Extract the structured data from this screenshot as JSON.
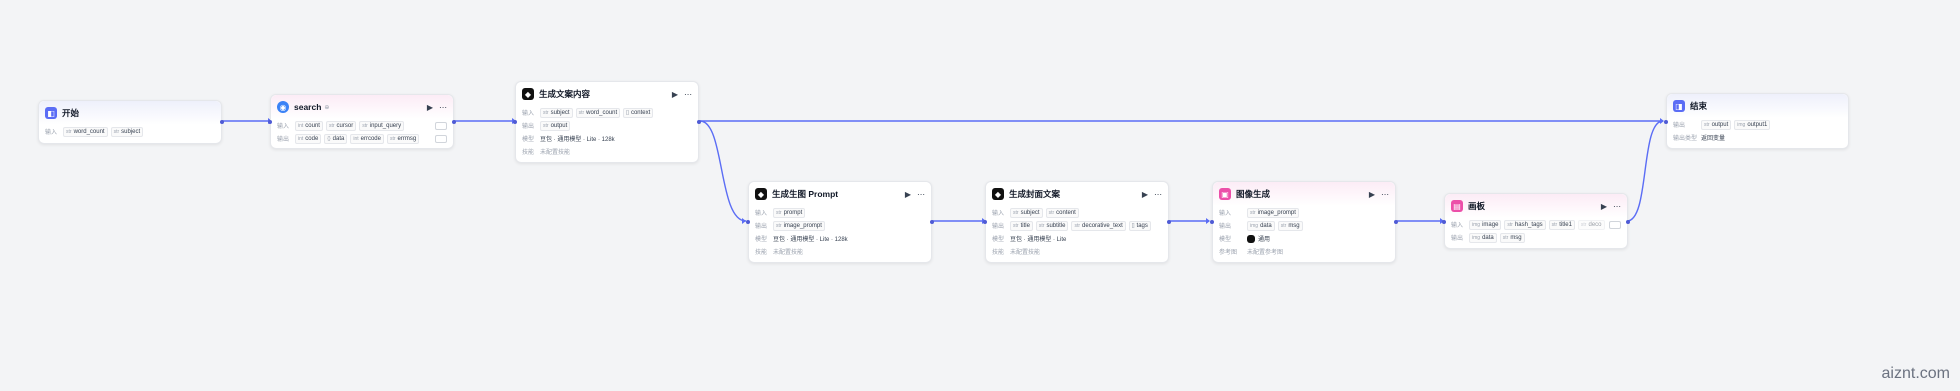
{
  "labels": {
    "input": "输入",
    "output": "输出",
    "model": "模型",
    "skill": "技能",
    "output_type": "输出类型",
    "reference": "参考图"
  },
  "nodes": {
    "start": {
      "title": "开始",
      "inputs": [
        "word_count",
        "subject"
      ]
    },
    "search": {
      "title": "search",
      "inputs": [
        "count",
        "cursor",
        "input_query"
      ],
      "outputs": [
        "code",
        "data",
        "errcode",
        "errmsg"
      ]
    },
    "gen_content": {
      "title": "生成文案内容",
      "inputs": [
        "subject",
        "word_count",
        "context"
      ],
      "outputs": [
        "output"
      ],
      "model": "豆包 · 通用模型 · Lite · 128k",
      "skill": "未配置技能"
    },
    "gen_prompt": {
      "title": "生成生图 Prompt",
      "inputs": [
        "prompt"
      ],
      "outputs": [
        "image_prompt"
      ],
      "model": "豆包 · 通用模型 · Lite · 128k",
      "skill": "未配置技能"
    },
    "gen_cover": {
      "title": "生成封面文案",
      "inputs": [
        "subject",
        "content"
      ],
      "outputs": [
        "title",
        "subtitle",
        "decorative_text",
        "tags"
      ],
      "model": "豆包 · 通用模型 · Lite",
      "skill": "未配置技能"
    },
    "image_gen": {
      "title": "图像生成",
      "inputs": [
        "image_prompt"
      ],
      "outputs": [
        "data",
        "msg"
      ],
      "model": "通用",
      "reference": "未配置参考图"
    },
    "canvas": {
      "title": "画板",
      "inputs": [
        "image",
        "hash_tags",
        "title1",
        "deco"
      ],
      "outputs": [
        "data",
        "msg"
      ]
    },
    "end": {
      "title": "结束",
      "outputs": [
        "output",
        "output1"
      ],
      "output_type": "返回变量"
    }
  },
  "watermark": "aiznt.com"
}
